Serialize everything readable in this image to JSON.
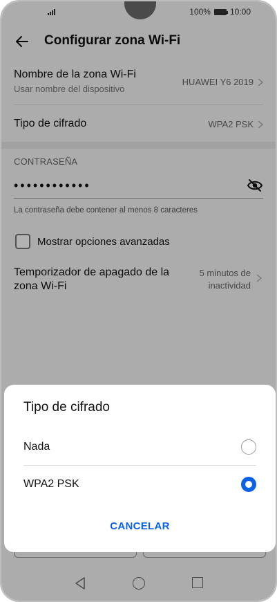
{
  "status_bar": {
    "battery_text": "100%",
    "time": "10:00"
  },
  "header": {
    "title": "Configurar zona Wi-Fi"
  },
  "settings": {
    "hotspot_name": {
      "title": "Nombre de la zona Wi-Fi",
      "subtitle": "Usar nombre del dispositivo",
      "value": "HUAWEI Y6 2019"
    },
    "encryption": {
      "title": "Tipo de cifrado",
      "value": "WPA2 PSK"
    },
    "password": {
      "section_label": "CONTRASEÑA",
      "value": "••••••••••••",
      "helper": "La contraseña debe contener al menos 8 caracteres"
    },
    "advanced": {
      "label": "Mostrar opciones avanzadas",
      "checked": false
    },
    "timer": {
      "title": "Temporizador de apagado de la zona Wi-Fi",
      "value": "5 minutos de inactividad"
    }
  },
  "dialog": {
    "title": "Tipo de cifrado",
    "options": [
      {
        "label": "Nada",
        "selected": false
      },
      {
        "label": "WPA2 PSK",
        "selected": true
      }
    ],
    "cancel_label": "CANCELAR"
  },
  "colors": {
    "accent": "#0a62e8"
  }
}
